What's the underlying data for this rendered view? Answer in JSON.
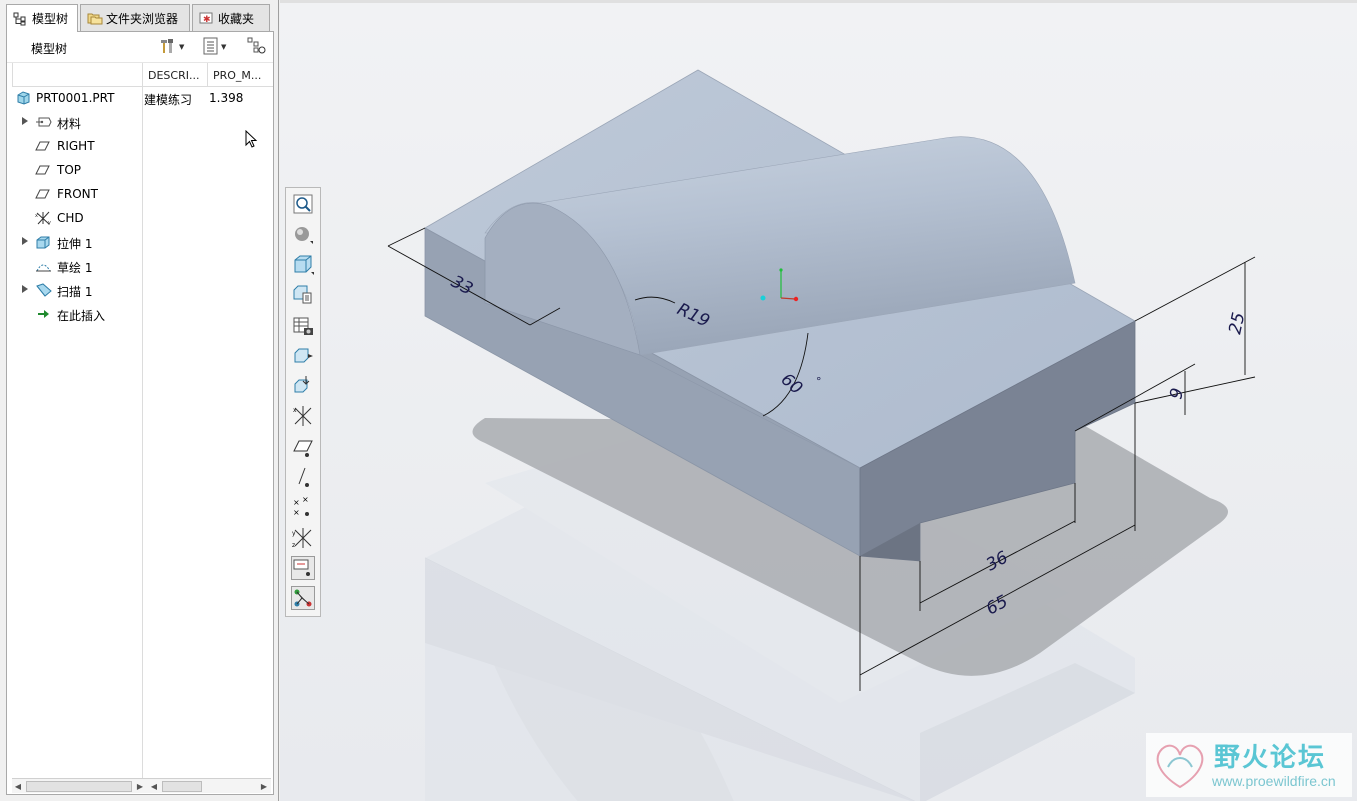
{
  "tabs": [
    {
      "label": "模型树",
      "icon": "model-tree-icon"
    },
    {
      "label": "文件夹浏览器",
      "icon": "folder-browser-icon"
    },
    {
      "label": "收藏夹",
      "icon": "favorites-icon"
    }
  ],
  "tree_toolbar": {
    "title": "模型树",
    "settings_icon": "tools-icon",
    "show_icon": "list-icon",
    "filter_icon": "tree-filter-icon"
  },
  "columns": [
    "DESCRI...",
    "PRO_M..."
  ],
  "tree": {
    "root": {
      "label": "PRT0001.PRT",
      "description": "建模练习",
      "pro_m": "1.398"
    },
    "items": [
      {
        "label": "材料",
        "icon": "material-icon",
        "expandable": true
      },
      {
        "label": "RIGHT",
        "icon": "datum-plane-icon",
        "expandable": false
      },
      {
        "label": "TOP",
        "icon": "datum-plane-icon",
        "expandable": false
      },
      {
        "label": "FRONT",
        "icon": "datum-plane-icon",
        "expandable": false
      },
      {
        "label": "CHD",
        "icon": "coordinate-system-icon",
        "expandable": false
      },
      {
        "label": "拉伸 1",
        "icon": "extrude-icon",
        "expandable": true
      },
      {
        "label": "草绘 1",
        "icon": "sketch-icon",
        "expandable": false
      },
      {
        "label": "扫描 1",
        "icon": "sweep-icon",
        "expandable": true
      },
      {
        "label": "在此插入",
        "icon": "insert-here-icon",
        "expandable": false
      }
    ]
  },
  "vertical_toolbar": [
    "zoom-icon",
    "appearance-icon",
    "display-style-icon",
    "saved-views-icon",
    "view-manager-icon",
    "reorient-icon",
    "spin-center-icon",
    "csys-display-icon",
    "plane-display-icon",
    "axis-display-icon",
    "point-display-icon",
    "csys-tag-icon",
    "annotation-display-icon",
    "connection-icon"
  ],
  "dimensions": {
    "d1": "33",
    "d2": "R19",
    "d3": "60",
    "d3_unit": "°",
    "d4": "25",
    "d5": "9",
    "d6": "36",
    "d7": "65"
  },
  "watermark": {
    "name": "野火论坛",
    "url": "www.proewildfire.cn"
  },
  "colors": {
    "part_top": "#b7c2d2",
    "part_front": "#8f9aab",
    "part_side": "#7a8394",
    "dim_text": "#1a1a4d"
  }
}
